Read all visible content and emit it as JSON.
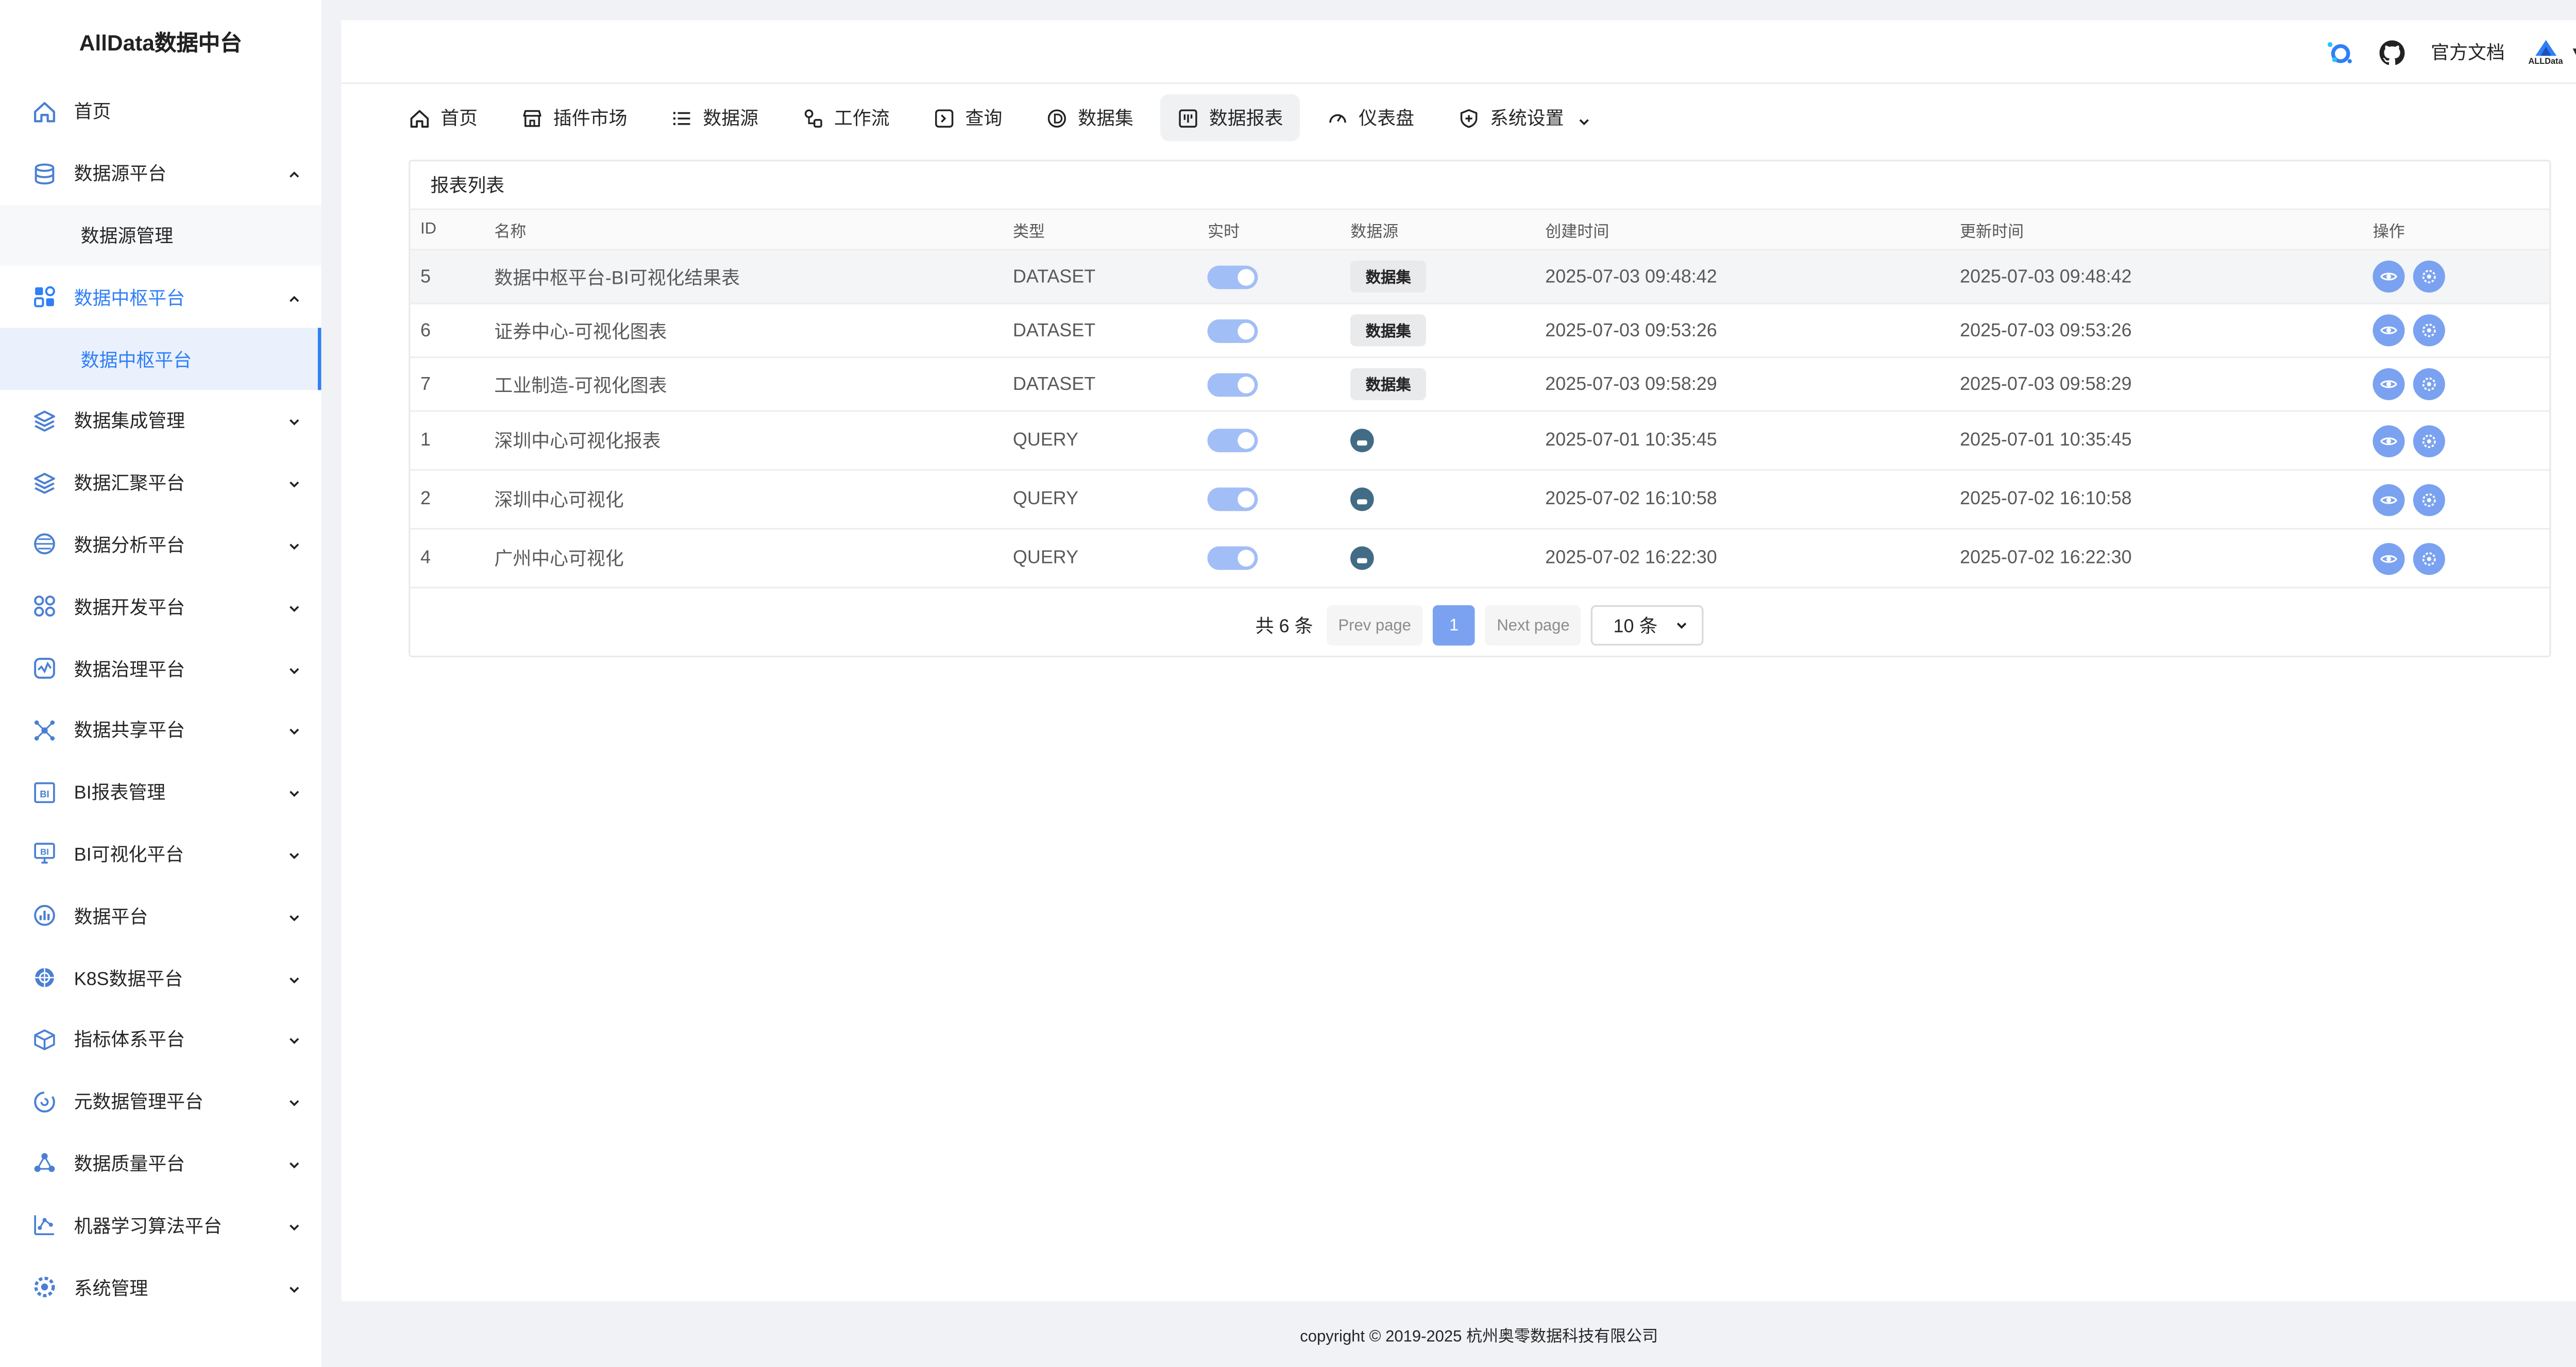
{
  "sidebar": {
    "title": "AllData数据中台",
    "items": [
      {
        "label": "首页",
        "icon": "home-icon",
        "expanded": null,
        "active": false
      },
      {
        "label": "数据源平台",
        "icon": "database-icon",
        "expanded": true,
        "active": false,
        "children": [
          {
            "label": "数据源管理",
            "active": false
          }
        ]
      },
      {
        "label": "数据中枢平台",
        "icon": "apps-icon",
        "expanded": true,
        "active": true,
        "children": [
          {
            "label": "数据中枢平台",
            "active": true
          }
        ]
      },
      {
        "label": "数据集成管理",
        "icon": "layers-icon",
        "expanded": false,
        "active": false
      },
      {
        "label": "数据汇聚平台",
        "icon": "layers-icon",
        "expanded": false,
        "active": false
      },
      {
        "label": "数据分析平台",
        "icon": "globe-icon",
        "expanded": false,
        "active": false
      },
      {
        "label": "数据开发平台",
        "icon": "grid-circles-icon",
        "expanded": false,
        "active": false
      },
      {
        "label": "数据治理平台",
        "icon": "pulse-icon",
        "expanded": false,
        "active": false
      },
      {
        "label": "数据共享平台",
        "icon": "share-hub-icon",
        "expanded": false,
        "active": false
      },
      {
        "label": "BI报表管理",
        "icon": "bi-report-icon",
        "expanded": false,
        "active": false
      },
      {
        "label": "BI可视化平台",
        "icon": "bi-monitor-icon",
        "expanded": false,
        "active": false
      },
      {
        "label": "数据平台",
        "icon": "bar-chart-circle-icon",
        "expanded": false,
        "active": false
      },
      {
        "label": "K8S数据平台",
        "icon": "k8s-globe-icon",
        "expanded": false,
        "active": false
      },
      {
        "label": "指标体系平台",
        "icon": "cube-icon",
        "expanded": false,
        "active": false
      },
      {
        "label": "元数据管理平台",
        "icon": "refresh-circle-icon",
        "expanded": false,
        "active": false
      },
      {
        "label": "数据质量平台",
        "icon": "molecule-icon",
        "expanded": false,
        "active": false
      },
      {
        "label": "机器学习算法平台",
        "icon": "ml-graph-icon",
        "expanded": false,
        "active": false
      },
      {
        "label": "系统管理",
        "icon": "settings-gear-icon",
        "expanded": false,
        "active": false
      }
    ]
  },
  "topbar": {
    "docs_label": "官方文档",
    "brand": "ALLData",
    "user_caret": "▼"
  },
  "nav": [
    {
      "label": "首页",
      "icon": "home-icon",
      "active": false
    },
    {
      "label": "插件市场",
      "icon": "store-icon",
      "active": false
    },
    {
      "label": "数据源",
      "icon": "list-icon",
      "active": false
    },
    {
      "label": "工作流",
      "icon": "workflow-icon",
      "active": false
    },
    {
      "label": "查询",
      "icon": "terminal-icon",
      "active": false
    },
    {
      "label": "数据集",
      "icon": "dataset-icon",
      "active": false
    },
    {
      "label": "数据报表",
      "icon": "report-icon",
      "active": true
    },
    {
      "label": "仪表盘",
      "icon": "gauge-icon",
      "active": false
    },
    {
      "label": "系统设置",
      "icon": "shield-icon",
      "active": false,
      "has_dropdown": true
    }
  ],
  "panel": {
    "title": "报表列表",
    "columns": [
      "ID",
      "名称",
      "类型",
      "实时",
      "数据源",
      "创建时间",
      "更新时间",
      "操作"
    ],
    "rows": [
      {
        "id": "5",
        "name": "数据中枢平台-BI可视化结果表",
        "type": "DATASET",
        "realtime": true,
        "source": "数据集",
        "created": "2025-07-03 09:48:42",
        "updated": "2025-07-03 09:48:42"
      },
      {
        "id": "6",
        "name": "证券中心-可视化图表",
        "type": "DATASET",
        "realtime": true,
        "source": "数据集",
        "created": "2025-07-03 09:53:26",
        "updated": "2025-07-03 09:53:26"
      },
      {
        "id": "7",
        "name": "工业制造-可视化图表",
        "type": "DATASET",
        "realtime": true,
        "source": "数据集",
        "created": "2025-07-03 09:58:29",
        "updated": "2025-07-03 09:58:29"
      },
      {
        "id": "1",
        "name": "深圳中心可视化报表",
        "type": "QUERY",
        "realtime": true,
        "source": "",
        "created": "2025-07-01 10:35:45",
        "updated": "2025-07-01 10:35:45"
      },
      {
        "id": "2",
        "name": "深圳中心可视化",
        "type": "QUERY",
        "realtime": true,
        "source": "",
        "created": "2025-07-02 16:10:58",
        "updated": "2025-07-02 16:10:58"
      },
      {
        "id": "4",
        "name": "广州中心可视化",
        "type": "QUERY",
        "realtime": true,
        "source": "",
        "created": "2025-07-02 16:22:30",
        "updated": "2025-07-02 16:22:30"
      }
    ],
    "pagination": {
      "total_label": "共 6 条",
      "prev_label": "Prev page",
      "current_page": "1",
      "next_label": "Next page",
      "page_size": "10 条"
    }
  },
  "footer": {
    "text": "copyright © 2019-2025 杭州奥零数据科技有限公司"
  },
  "colors": {
    "accent": "#2f7ff6",
    "toggle_on": "#a2bef6",
    "action_icon": "#7aa2f0",
    "datasource_icon": "#426c85"
  }
}
